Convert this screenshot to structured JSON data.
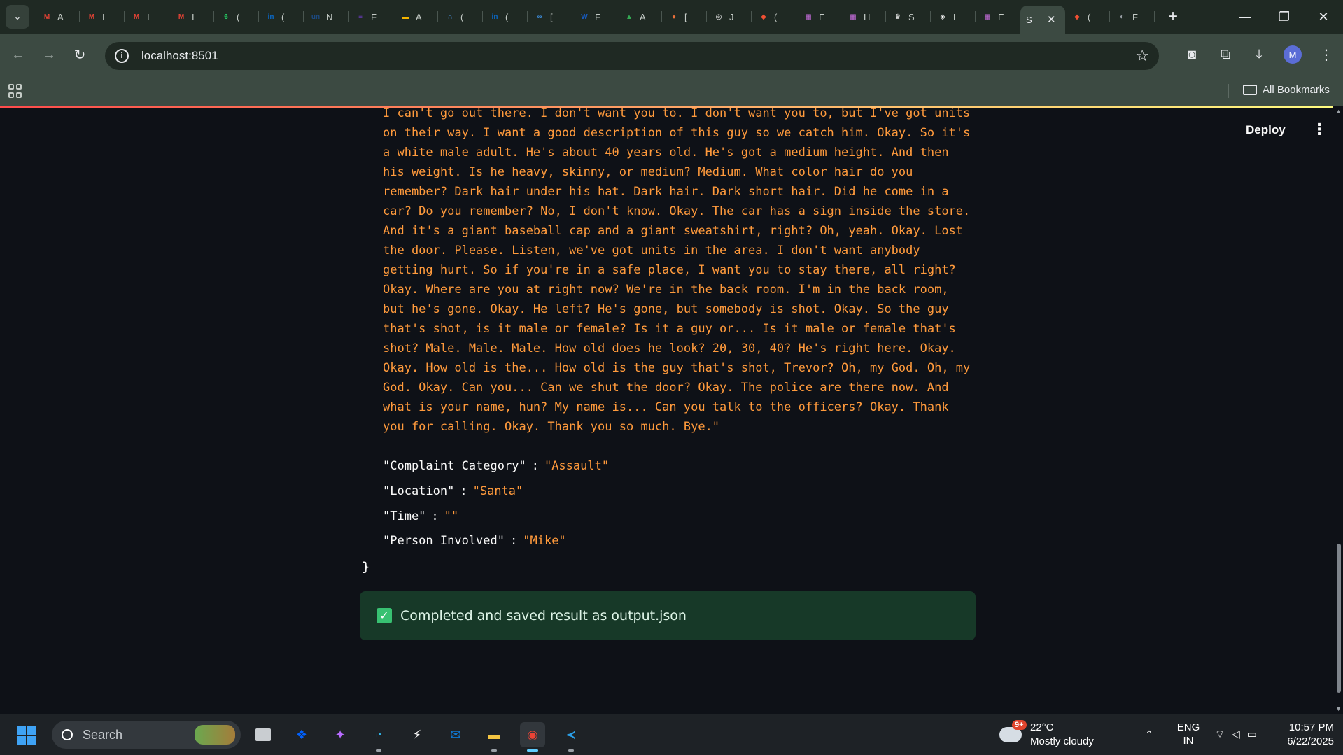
{
  "browser": {
    "tabs": [
      {
        "icon": "gmail-icon",
        "letter": "M",
        "color": "#ea4335",
        "title": "A"
      },
      {
        "icon": "gmail-icon",
        "letter": "M",
        "color": "#ea4335",
        "title": "I"
      },
      {
        "icon": "gmail-icon",
        "letter": "M",
        "color": "#ea4335",
        "title": "I"
      },
      {
        "icon": "gmail-icon",
        "letter": "M",
        "color": "#ea4335",
        "title": "I"
      },
      {
        "icon": "whatsapp-icon",
        "letter": "6",
        "color": "#25d366",
        "title": "("
      },
      {
        "icon": "linkedin-icon",
        "letter": "in",
        "color": "#0a66c2",
        "title": "("
      },
      {
        "icon": "unstop-icon",
        "letter": "un",
        "color": "#1c4980",
        "title": "N"
      },
      {
        "icon": "forms-icon",
        "letter": "≡",
        "color": "#673ab7",
        "title": "F"
      },
      {
        "icon": "slides-icon",
        "letter": "▬",
        "color": "#f4b400",
        "title": "A"
      },
      {
        "icon": "headphones-icon",
        "letter": "∩",
        "color": "#4a90d9",
        "title": "("
      },
      {
        "icon": "linkedin-icon",
        "letter": "in",
        "color": "#0a66c2",
        "title": "("
      },
      {
        "icon": "link-icon",
        "letter": "∞",
        "color": "#3d8fe0",
        "title": "["
      },
      {
        "icon": "word-icon",
        "letter": "W",
        "color": "#185abd",
        "title": "F"
      },
      {
        "icon": "drive-icon",
        "letter": "▲",
        "color": "#34a853",
        "title": "A"
      },
      {
        "icon": "ball-icon",
        "letter": "●",
        "color": "#e8703a",
        "title": "["
      },
      {
        "icon": "openai-icon",
        "letter": "◎",
        "color": "#ffffff",
        "title": "J"
      },
      {
        "icon": "git-icon",
        "letter": "◆",
        "color": "#f05033",
        "title": "("
      },
      {
        "icon": "colorgrid-icon",
        "letter": "▦",
        "color": "#c26bd8",
        "title": "E"
      },
      {
        "icon": "colorgrid-icon",
        "letter": "▦",
        "color": "#c26bd8",
        "title": "H"
      },
      {
        "icon": "crown-icon",
        "letter": "♛",
        "color": "#ffffff",
        "title": "S"
      },
      {
        "icon": "lens-icon",
        "letter": "◈",
        "color": "#ffffff",
        "title": "L"
      },
      {
        "icon": "colorgrid-icon",
        "letter": "▦",
        "color": "#c26bd8",
        "title": "E"
      }
    ],
    "active_tab": {
      "title": "S",
      "close": "✕"
    },
    "tabs_after": [
      {
        "icon": "git-icon",
        "letter": "◆",
        "color": "#f05033",
        "title": "("
      },
      {
        "icon": "globe-icon",
        "letter": "◐",
        "color": "#9aa0a6",
        "title": "F"
      }
    ],
    "new_tab": "+",
    "window_controls": {
      "minimize": "—",
      "maximize": "❐",
      "close": "✕"
    },
    "url": "localhost:8501",
    "avatar_letter": "M",
    "bookmarks_label": "All Bookmarks"
  },
  "app": {
    "deploy_label": "Deploy",
    "menu_glyph": "⋮",
    "transcript": "I can't go out there. I don't want you to. I don't want you to, but I've got units on their way. I want a good description of this guy so we catch him. Okay. So it's a white male adult. He's about 40 years old. He's got a medium height. And then his weight. Is he heavy, skinny, or medium? Medium. What color hair do you remember? Dark hair under his hat. Dark hair. Dark short hair. Did he come in a car? Do you remember? No, I don't know. Okay. The car has a sign inside the store. And it's a giant baseball cap and a giant sweatshirt, right? Oh, yeah. Okay. Lost the door. Please. Listen, we've got units in the area. I don't want anybody getting hurt. So if you're in a safe place, I want you to stay there, all right? Okay. Where are you at right now? We're in the back room. I'm in the back room, but he's gone. Okay. He left? He's gone, but somebody is shot. Okay. So the guy that's shot, is it male or female? Is it a guy or... Is it male or female that's shot? Male. Male. Male. How old does he look? 20, 30, 40? He's right here. Okay. Okay. How old is the... How old is the guy that's shot, Trevor? Oh, my God. Oh, my God. Okay. Can you... Can we shut the door? Okay. The police are there now. And what is your name, hun? My name is... Can you talk to the officers? Okay. Thank you for calling. Okay. Thank you so much. Bye.\"",
    "fields": [
      {
        "key": "\"Complaint Category\"",
        "value": "\"Assault\""
      },
      {
        "key": "\"Location\"",
        "value": "\"Santa\""
      },
      {
        "key": "\"Time\"",
        "value": "\"\""
      },
      {
        "key": "\"Person Involved\"",
        "value": "\"Mike\""
      }
    ],
    "closing_brace": "}",
    "success_message": "Completed and saved result as output.json"
  },
  "taskbar": {
    "search_label": "Search",
    "weather_temp": "22°C",
    "weather_desc": "Mostly cloudy",
    "weather_badge": "9+",
    "lang_line1": "ENG",
    "lang_line2": "IN",
    "time": "10:57 PM",
    "date": "6/22/2025"
  }
}
